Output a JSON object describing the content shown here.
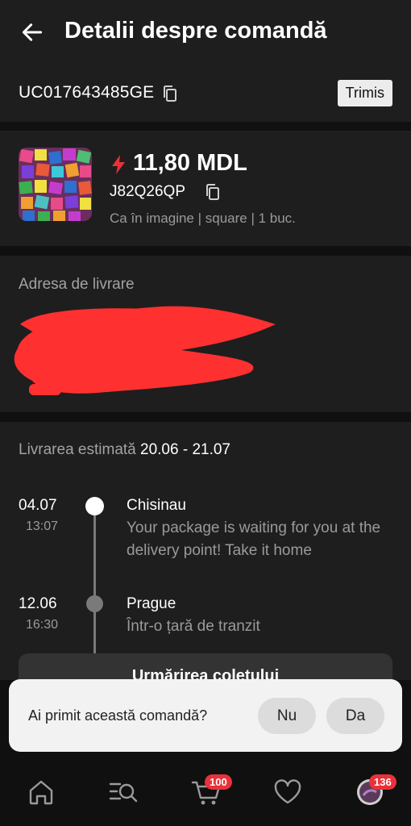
{
  "header": {
    "title": "Detalii despre comandă"
  },
  "order": {
    "tracking_number": "UC017643485GE",
    "status": "Trimis"
  },
  "product": {
    "price": "11,80 MDL",
    "sku": "J82Q26QP",
    "variant": "Ca în imagine | square | 1 buc."
  },
  "address": {
    "label": "Adresa de livrare"
  },
  "delivery": {
    "estimate_label": "Livrarea estimată",
    "estimate_value": "20.06 - 21.07",
    "events": [
      {
        "date": "04.07",
        "time": "13:07",
        "location": "Chisinau",
        "description": "Your package is waiting for you at the delivery point! Take it home"
      },
      {
        "date": "12.06",
        "time": "16:30",
        "location": "Prague",
        "description": "Într-o țară de tranzit"
      }
    ],
    "track_button": "Urmărirea coletului"
  },
  "dialog": {
    "question": "Ai primit această comandă?",
    "no": "Nu",
    "yes": "Da"
  },
  "nav": {
    "cart_badge": "100",
    "profile_badge": "136"
  },
  "colors": {
    "accent": "#e8323a",
    "background": "#101010",
    "card": "#1e1e1e"
  }
}
